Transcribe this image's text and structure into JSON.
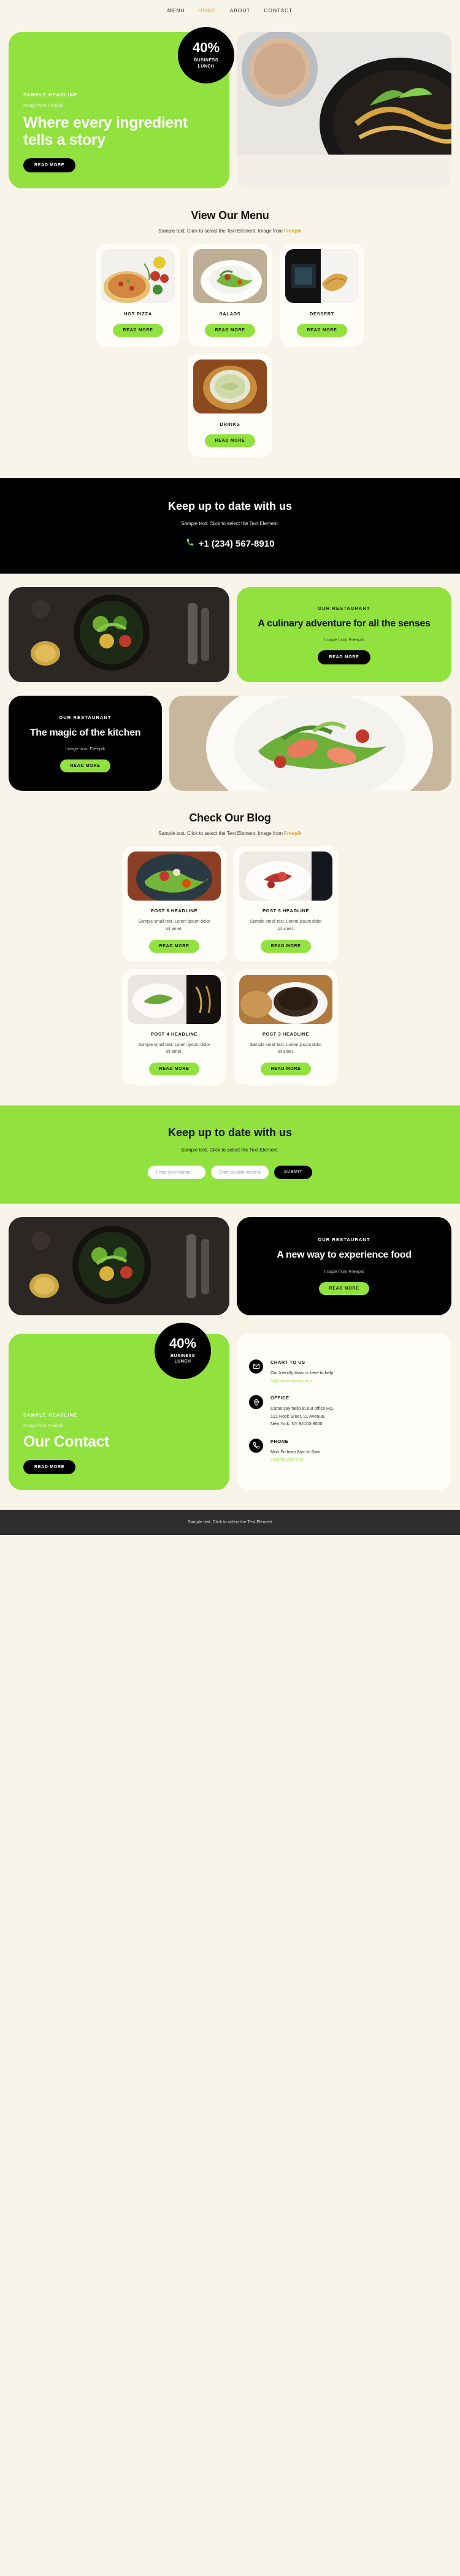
{
  "nav": {
    "items": [
      {
        "label": "MENU",
        "active": false
      },
      {
        "label": "HOME",
        "active": true
      },
      {
        "label": "ABOUT",
        "active": false
      },
      {
        "label": "CONTACT",
        "active": false
      }
    ]
  },
  "colors": {
    "brand_green": "#92e23f",
    "accent_gold": "#d6a43a",
    "background": "#f7f4ea",
    "dark": "#000000",
    "footer": "#2e2e2e"
  },
  "badge": {
    "percent": "40%",
    "line1": "BUSINESS",
    "line2": "LUNCH"
  },
  "hero": {
    "eyebrow": "SAMPLE HEADLINE",
    "credit": "Image from Freepik",
    "headline": "Where every ingredient tells a story",
    "cta": "READ MORE"
  },
  "menu_section": {
    "title": "View Our Menu",
    "subtitle_prefix": "Sample text. Click to select the Text Element. Image from ",
    "subtitle_link": "Freepik",
    "cards": [
      {
        "title": "HOT PIZZA",
        "cta": "READ MORE"
      },
      {
        "title": "SALADS",
        "cta": "READ MORE"
      },
      {
        "title": "DESSERT",
        "cta": "READ MORE"
      },
      {
        "title": "DRINKS",
        "cta": "READ MORE"
      }
    ]
  },
  "cta_dark": {
    "title": "Keep up to date with us",
    "text": "Sample text. Click to select the Text Element.",
    "phone": "+1 (234) 567-8910"
  },
  "feature_one": {
    "eyebrow": "OUR RESTAURANT",
    "headline": "A culinary adventure for all the senses",
    "credit": "Image from Freepik",
    "cta": "READ MORE"
  },
  "feature_two": {
    "eyebrow": "OUR RESTAURANT",
    "headline": "The magic of the kitchen",
    "credit": "Image from Freepik",
    "cta": "READ MORE"
  },
  "blog_section": {
    "title": "Check Our Blog",
    "subtitle_prefix": "Sample text. Click to select the Text Element. Image from ",
    "subtitle_link": "Freepik",
    "posts": [
      {
        "title": "POST 6 HEADLINE",
        "desc": "Sample small text. Lorem ipsum dolor sit amet.",
        "cta": "READ MORE"
      },
      {
        "title": "POST 5 HEADLINE",
        "desc": "Sample small text. Lorem ipsum dolor sit amet.",
        "cta": "READ MORE"
      },
      {
        "title": "POST 4 HEADLINE",
        "desc": "Sample small text. Lorem ipsum dolor sit amet.",
        "cta": "READ MORE"
      },
      {
        "title": "POST 3 HEADLINE",
        "desc": "Sample small text. Lorem ipsum dolor sit amet.",
        "cta": "READ MORE"
      }
    ]
  },
  "newsletter": {
    "title": "Keep up to date with us",
    "text": "Sample text. Click to select the Text Element.",
    "name_placeholder": "Enter your Name",
    "name_value": "",
    "email_placeholder": "Enter a valid email address",
    "email_value": "",
    "submit": "SUBMIT"
  },
  "feature_three": {
    "eyebrow": "OUR RESTAURANT",
    "headline": "A new way to experience food",
    "credit": "Image from Freepik",
    "cta": "READ MORE"
  },
  "contact": {
    "eyebrow": "SAMPLE HEADLINE",
    "credit": "Image from Freepik",
    "headline": "Our Contact",
    "cta": "READ MORE",
    "blocks": [
      {
        "icon": "envelope-icon",
        "title": "CHART TO US",
        "line1": "Our friendly team is here to help.",
        "line2": "",
        "link": "hi@ourcompany.com"
      },
      {
        "icon": "map-pin-icon",
        "title": "OFFICE",
        "line1": "Come say hello at our office HQ.",
        "line2": "121 Rock Sreet, 21 Avenue,",
        "line3": "New York, NY 92103-9000",
        "link": ""
      },
      {
        "icon": "phone-icon",
        "title": "PHONE",
        "line1": "Mon-Fri from 8am to 5am",
        "line2": "",
        "link": "+1(555) 000-000"
      }
    ]
  },
  "footer": {
    "text": "Sample text. Click to select the Text Element"
  }
}
